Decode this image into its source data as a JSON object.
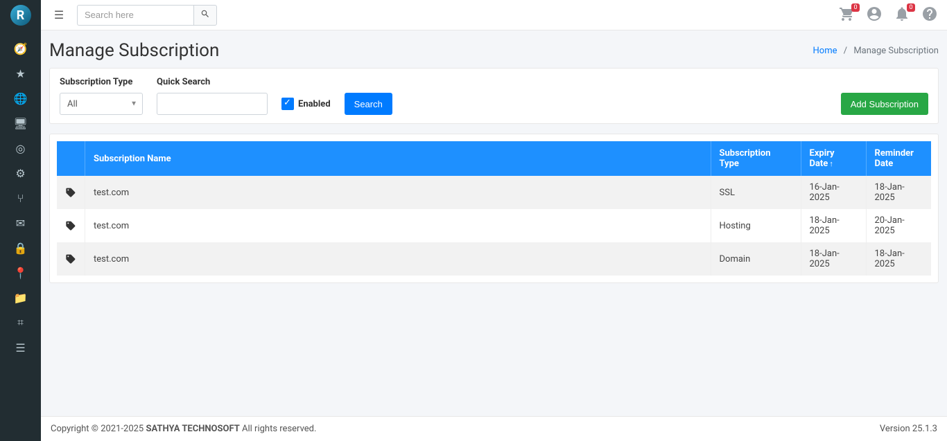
{
  "app": {
    "logo_letter": "R",
    "search_placeholder": "Search here",
    "cart_badge": "0",
    "bell_badge": "0"
  },
  "header": {
    "title": "Manage Subscription",
    "breadcrumb": {
      "home": "Home",
      "current": "Manage Subscription"
    }
  },
  "filters": {
    "type_label": "Subscription Type",
    "type_value": "All",
    "quick_label": "Quick Search",
    "quick_value": "",
    "enabled_label": "Enabled",
    "search_btn": "Search",
    "add_btn": "Add Subscription"
  },
  "table": {
    "columns": {
      "name": "Subscription Name",
      "type": "Subscription Type",
      "expiry": "Expiry Date",
      "reminder": "Reminder Date"
    },
    "rows": [
      {
        "name": "test.com",
        "type": "SSL",
        "expiry": "16-Jan-2025",
        "reminder": "18-Jan-2025"
      },
      {
        "name": "test.com",
        "type": "Hosting",
        "expiry": "18-Jan-2025",
        "reminder": "20-Jan-2025"
      },
      {
        "name": "test.com",
        "type": "Domain",
        "expiry": "18-Jan-2025",
        "reminder": "18-Jan-2025"
      }
    ]
  },
  "footer": {
    "prefix": "Copyright © 2021-2025 ",
    "brand": "SATHYA TECHNOSOFT",
    "suffix": " All rights reserved.",
    "version": "Version 25.1.3"
  }
}
